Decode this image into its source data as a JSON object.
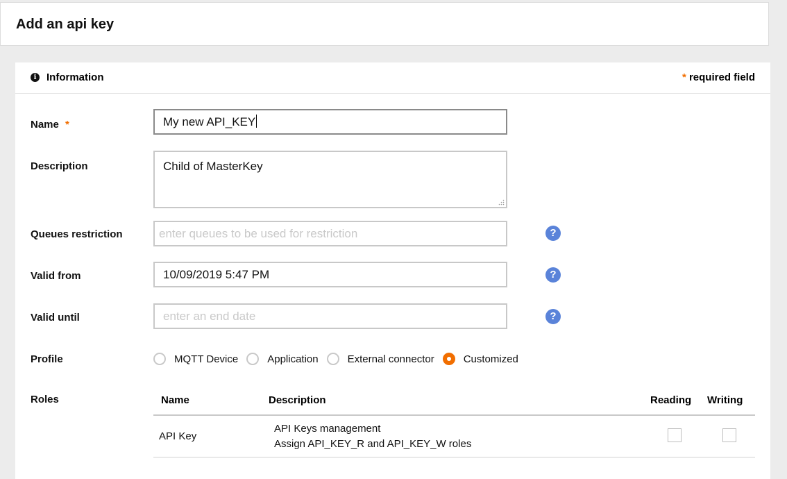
{
  "page": {
    "title": "Add an api key"
  },
  "card": {
    "title": "Information",
    "required_star": "*",
    "required_text": "required field"
  },
  "form": {
    "name": {
      "label": "Name",
      "required_star": "*",
      "value": "My new API_KEY"
    },
    "description": {
      "label": "Description",
      "value": "Child of MasterKey"
    },
    "queues": {
      "label": "Queues restriction",
      "placeholder": "enter queues to be used for restriction"
    },
    "valid_from": {
      "label": "Valid from",
      "value": "10/09/2019 5:47 PM"
    },
    "valid_until": {
      "label": "Valid until",
      "placeholder": "enter an end date"
    },
    "profile": {
      "label": "Profile",
      "options": [
        "MQTT Device",
        "Application",
        "External connector",
        "Customized"
      ],
      "selected": "Customized"
    },
    "roles": {
      "label": "Roles",
      "columns": [
        "Name",
        "Description",
        "Reading",
        "Writing"
      ],
      "rows": [
        {
          "name": "API Key",
          "description_line1": "API Keys management",
          "description_line2": "Assign API_KEY_R and API_KEY_W roles",
          "reading": false,
          "writing": false
        }
      ]
    }
  },
  "colors": {
    "accent": "#f16e00",
    "help": "#5a83d9"
  },
  "icons": {
    "info": "info-icon",
    "help": "question-mark-icon"
  }
}
